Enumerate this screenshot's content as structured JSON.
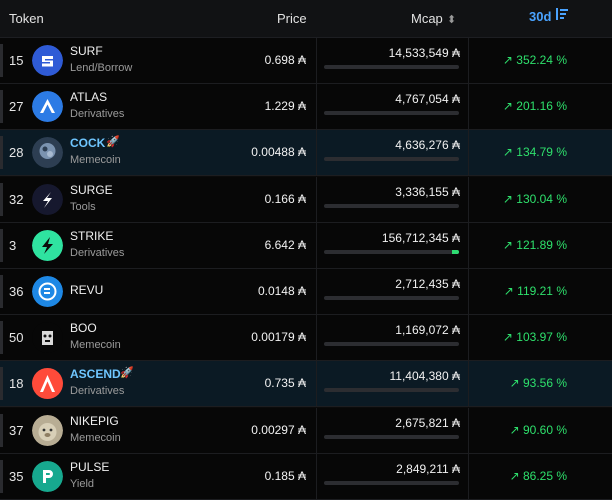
{
  "header": {
    "token": "Token",
    "price": "Price",
    "mcap": "Mcap",
    "period": "30d"
  },
  "currency_symbol": "₳",
  "colors": {
    "accent": "#4aa3ff",
    "positive": "#2ee06c",
    "highlight_row": "#0b1a24"
  },
  "rows": [
    {
      "rank": "15",
      "name": "SURF",
      "category": "Lend/Borrow",
      "price": "0.698 ₳",
      "mcap": "14,533,549 ₳",
      "change": "↗ 352.24 %",
      "icon": "surf-logo-icon",
      "bar_fraction": 0.0,
      "highlighted": false
    },
    {
      "rank": "27",
      "name": "ATLAS",
      "category": "Derivatives",
      "price": "1.229 ₳",
      "mcap": "4,767,054 ₳",
      "change": "↗ 201.16 %",
      "icon": "atlas-logo-icon",
      "bar_fraction": 0.0,
      "highlighted": false
    },
    {
      "rank": "28",
      "name": "COCK",
      "category": "Memecoin",
      "price": "0.00488 ₳",
      "mcap": "4,636,276 ₳",
      "change": "↗ 134.79 %",
      "icon": "cock-logo-icon",
      "bar_fraction": 0.0,
      "highlighted": true,
      "rocket": "rocket-icon"
    },
    {
      "rank": "32",
      "name": "SURGE",
      "category": "Tools",
      "price": "0.166 ₳",
      "mcap": "3,336,155 ₳",
      "change": "↗ 130.04 %",
      "icon": "surge-logo-icon",
      "bar_fraction": 0.0,
      "highlighted": false
    },
    {
      "rank": "3",
      "name": "STRIKE",
      "category": "Derivatives",
      "price": "6.642 ₳",
      "mcap": "156,712,345 ₳",
      "change": "↗ 121.89 %",
      "icon": "strike-logo-icon",
      "bar_fraction": 0.05,
      "highlighted": false
    },
    {
      "rank": "36",
      "name": "REVU",
      "category": "",
      "price": "0.0148 ₳",
      "mcap": "2,712,435 ₳",
      "change": "↗ 119.21 %",
      "icon": "revu-logo-icon",
      "bar_fraction": 0.0,
      "highlighted": false
    },
    {
      "rank": "50",
      "name": "BOO",
      "category": "Memecoin",
      "price": "0.00179 ₳",
      "mcap": "1,169,072 ₳",
      "change": "↗ 103.97 %",
      "icon": "boo-logo-icon",
      "bar_fraction": 0.0,
      "highlighted": false
    },
    {
      "rank": "18",
      "name": "ASCEND",
      "category": "Derivatives",
      "price": "0.735 ₳",
      "mcap": "11,404,380 ₳",
      "change": "↗ 93.56 %",
      "icon": "ascend-logo-icon",
      "bar_fraction": 0.0,
      "highlighted": true,
      "rocket": "rocket-icon"
    },
    {
      "rank": "37",
      "name": "NIKEPIG",
      "category": "Memecoin",
      "price": "0.00297 ₳",
      "mcap": "2,675,821 ₳",
      "change": "↗ 90.60 %",
      "icon": "nikepig-logo-icon",
      "bar_fraction": 0.0,
      "highlighted": false
    },
    {
      "rank": "35",
      "name": "PULSE",
      "category": "Yield",
      "price": "0.185 ₳",
      "mcap": "2,849,211 ₳",
      "change": "↗ 86.25 %",
      "icon": "pulse-logo-icon",
      "bar_fraction": 0.0,
      "highlighted": false
    }
  ]
}
